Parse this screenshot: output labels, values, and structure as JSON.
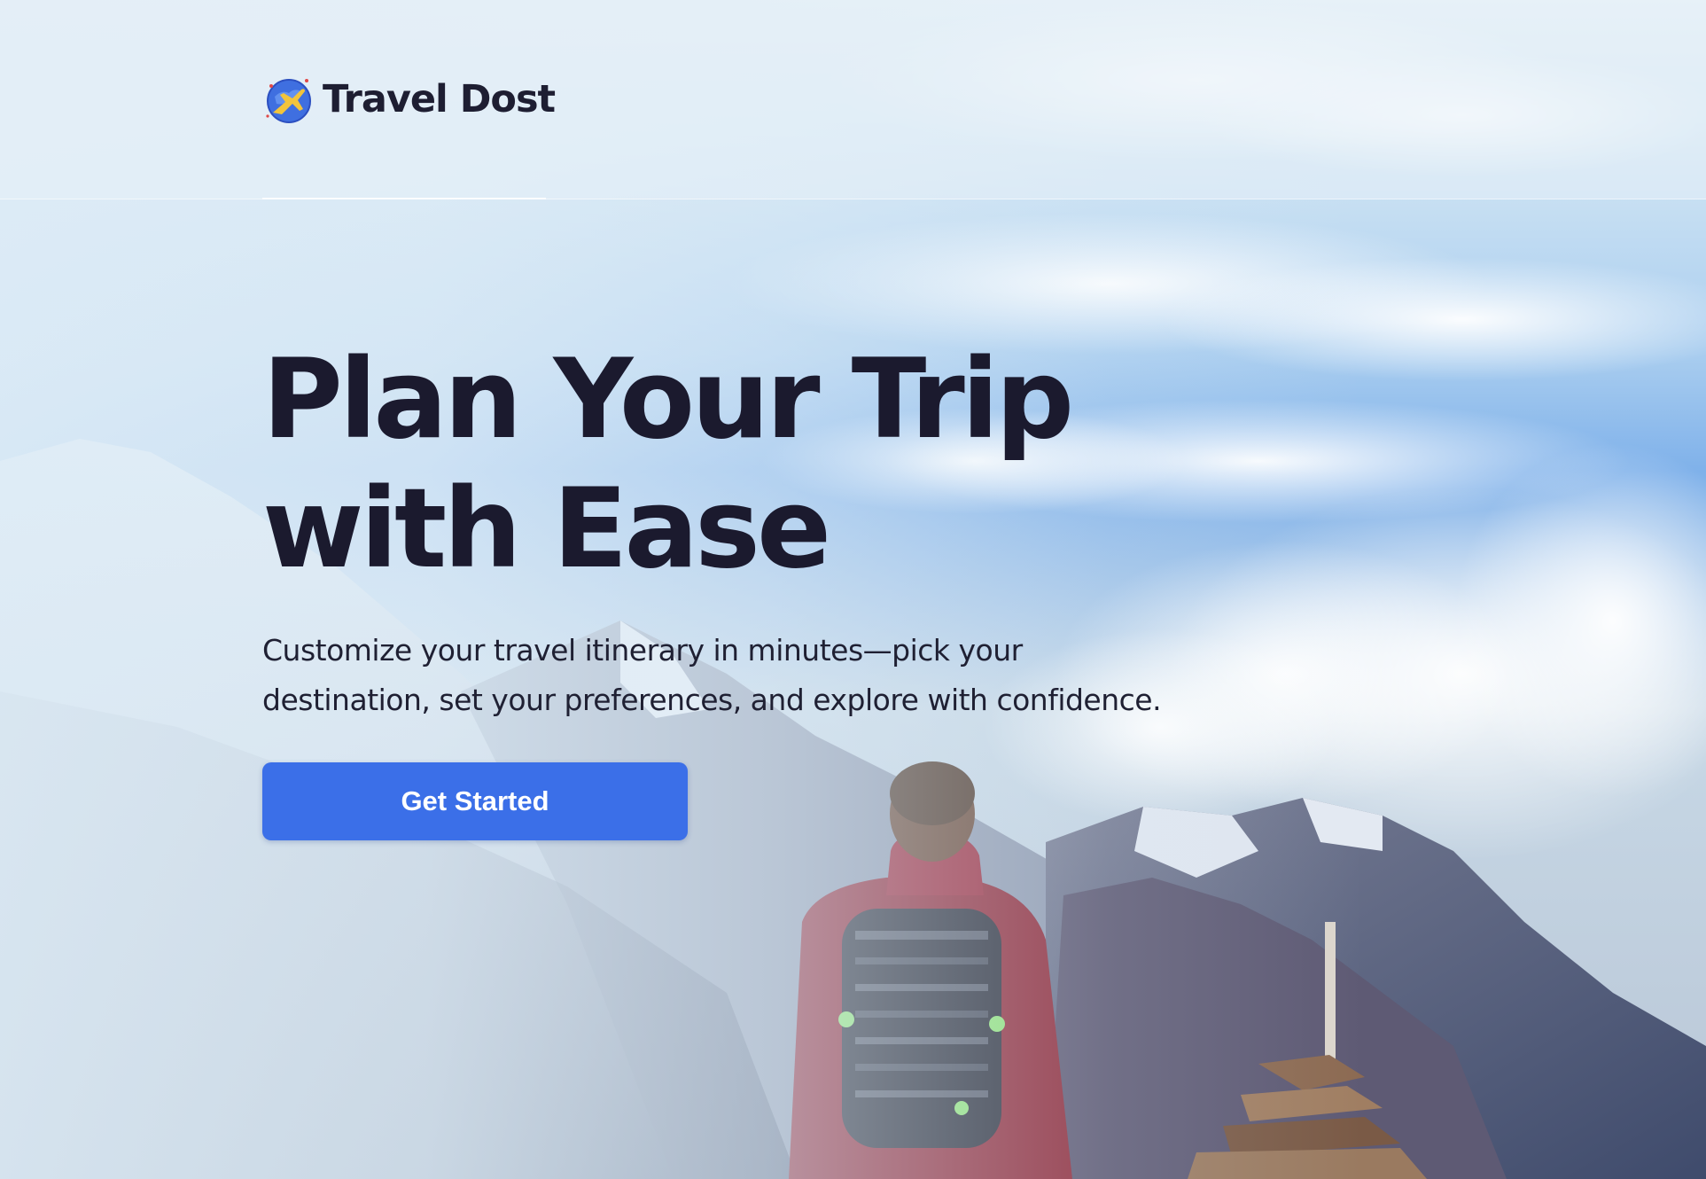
{
  "brand": {
    "name": "Travel Dost",
    "logo_icon": "airplane-globe-icon"
  },
  "hero": {
    "title_line1": "Plan Your Trip",
    "title_line2": "with Ease",
    "subtitle_line1": "Customize your travel itinerary in minutes—pick your",
    "subtitle_line2": "destination, set your preferences, and explore with confidence.",
    "cta_label": "Get Started"
  },
  "colors": {
    "accent": "#3b6fe8",
    "text_dark": "#1b1a2e"
  }
}
